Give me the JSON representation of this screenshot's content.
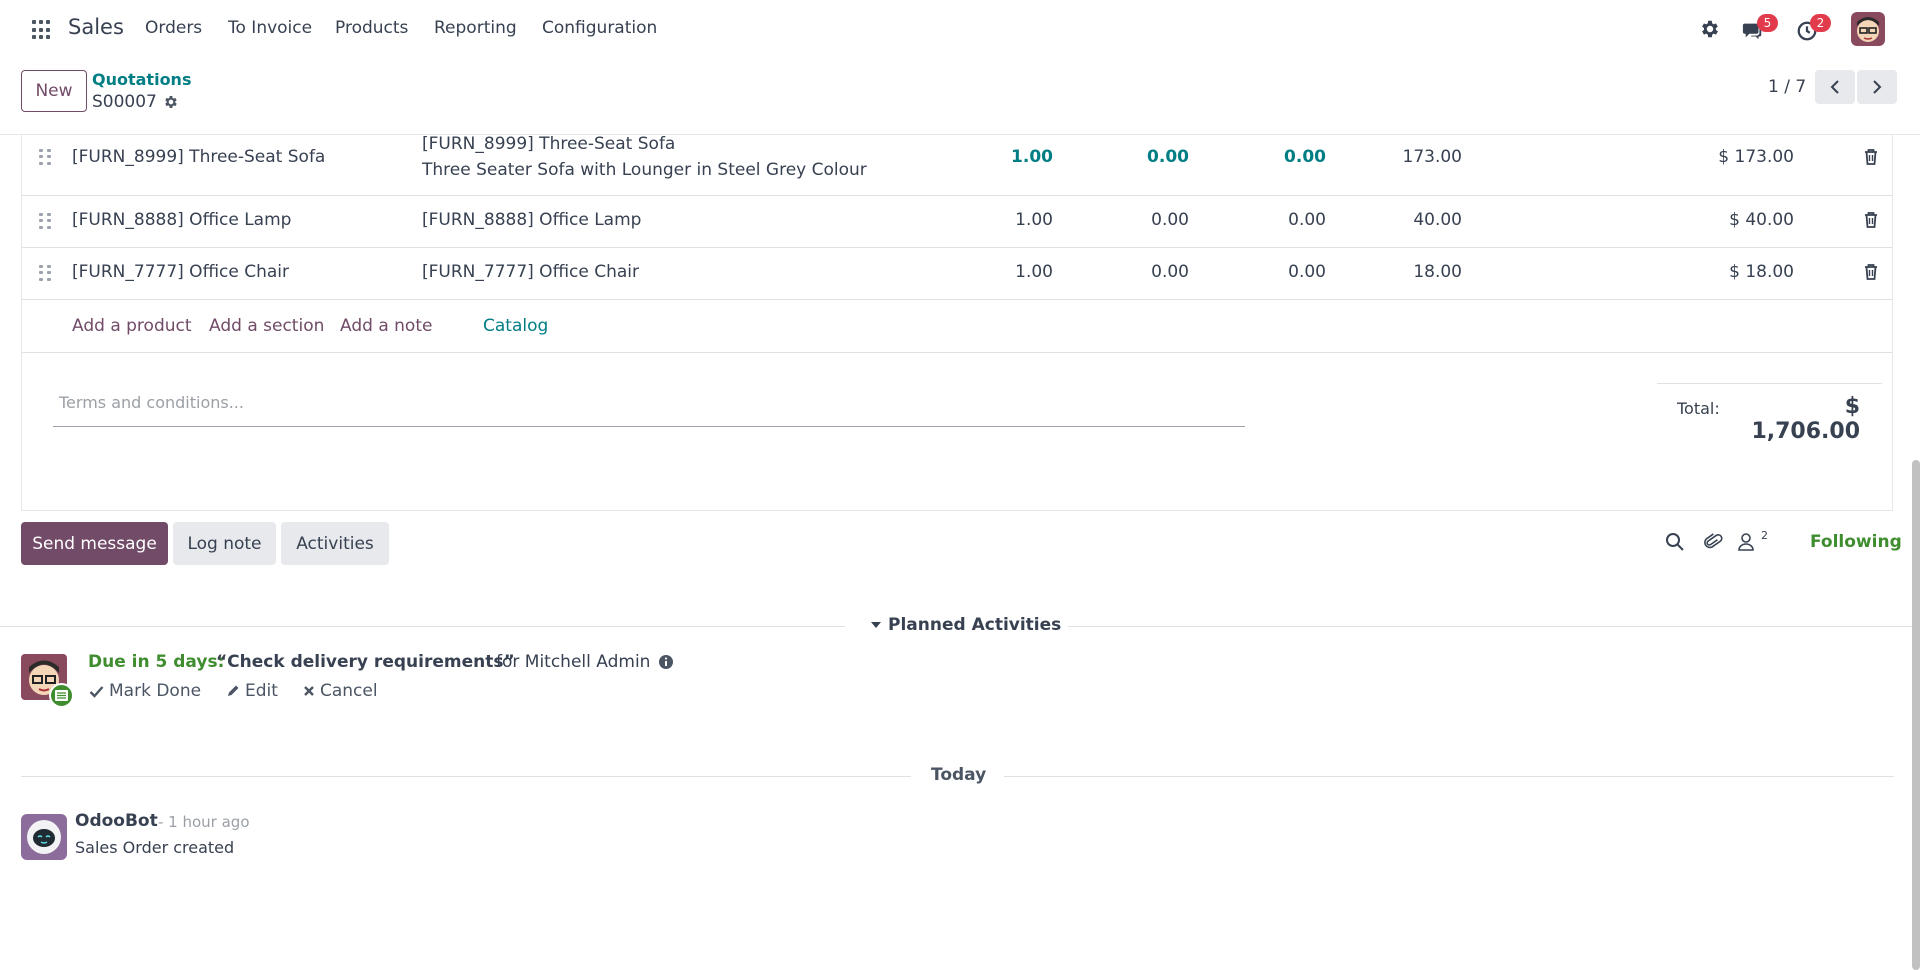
{
  "navbar": {
    "app_name": "Sales",
    "menu": [
      "Orders",
      "To Invoice",
      "Products",
      "Reporting",
      "Configuration"
    ],
    "messages_badge": "5",
    "activities_badge": "2"
  },
  "control": {
    "new_label": "New",
    "breadcrumb": "Quotations",
    "record_name": "S00007",
    "pager": "1 / 7"
  },
  "lines": [
    {
      "product": "[FURN_8999] Three-Seat Sofa",
      "description": "[FURN_8999] Three-Seat Sofa",
      "description_2": "Three Seater Sofa with Lounger in Steel Grey Colour",
      "qty": "1.00",
      "delivered": "0.00",
      "invoiced": "0.00",
      "unit_price": "173.00",
      "subtotal": "$ 173.00"
    },
    {
      "product": "[FURN_8888] Office Lamp",
      "description": "[FURN_8888] Office Lamp",
      "qty": "1.00",
      "delivered": "0.00",
      "invoiced": "0.00",
      "unit_price": "40.00",
      "subtotal": "$ 40.00"
    },
    {
      "product": "[FURN_7777] Office Chair",
      "description": "[FURN_7777] Office Chair",
      "qty": "1.00",
      "delivered": "0.00",
      "invoiced": "0.00",
      "unit_price": "18.00",
      "subtotal": "$ 18.00"
    }
  ],
  "add_links": {
    "product": "Add a product",
    "section": "Add a section",
    "note": "Add a note",
    "catalog": "Catalog"
  },
  "terms_placeholder": "Terms and conditions...",
  "totals": {
    "label": "Total:",
    "value": "$ 1,706.00"
  },
  "chatter": {
    "send_message": "Send message",
    "log_note": "Log note",
    "activities": "Activities",
    "followers_count": "2",
    "following": "Following"
  },
  "planned": {
    "title": "Planned Activities",
    "due": "Due in 5 days:",
    "summary": "“Check delivery requirements”",
    "for_user": "for Mitchell Admin",
    "mark_done": "Mark Done",
    "edit": "Edit",
    "cancel": "Cancel"
  },
  "messages": {
    "today": "Today",
    "author": "OdooBot",
    "time": "- 1 hour ago",
    "body": "Sales Order created"
  },
  "colors": {
    "primary": "#714b67",
    "teal": "#017e84",
    "success": "#3f8d2f",
    "badge": "#e23b4b"
  }
}
